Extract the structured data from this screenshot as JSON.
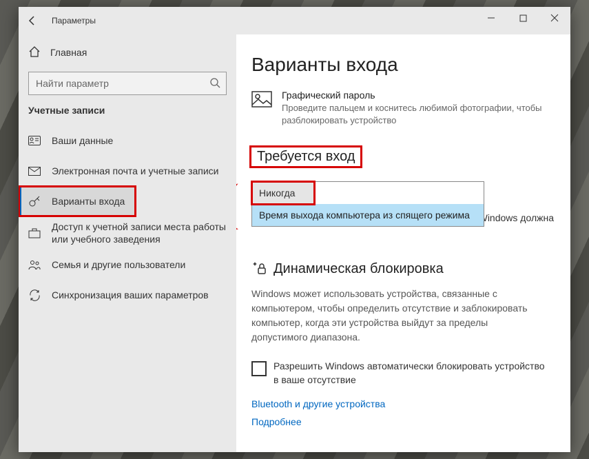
{
  "window": {
    "title": "Параметры"
  },
  "sidebar": {
    "home": "Главная",
    "search_placeholder": "Найти параметр",
    "section": "Учетные записи",
    "items": [
      {
        "label": "Ваши данные"
      },
      {
        "label": "Электронная почта и учетные записи"
      },
      {
        "label": "Варианты входа"
      },
      {
        "label": "Доступ к учетной записи места работы или учебного заведения"
      },
      {
        "label": "Семья и другие пользователи"
      },
      {
        "label": "Синхронизация ваших параметров"
      }
    ]
  },
  "main": {
    "title": "Варианты входа",
    "picture_password": {
      "title": "Графический пароль",
      "desc": "Проведите пальцем и коснитесь любимой фотографии, чтобы разблокировать устройство"
    },
    "require_signin": {
      "heading": "Требуется вход",
      "hint_tail": "Windows должна",
      "options": [
        "Никогда",
        "Время выхода компьютера из спящего режима"
      ]
    },
    "dynamic_lock": {
      "heading": "Динамическая блокировка",
      "desc": "Windows может использовать устройства, связанные с компьютером, чтобы определить отсутствие и заблокировать компьютер, когда эти устройства выйдут за пределы допустимого диапазона.",
      "checkbox": "Разрешить Windows автоматически блокировать устройство в ваше отсутствие",
      "link1": "Bluetooth и другие устройства",
      "link2": "Подробнее"
    }
  }
}
